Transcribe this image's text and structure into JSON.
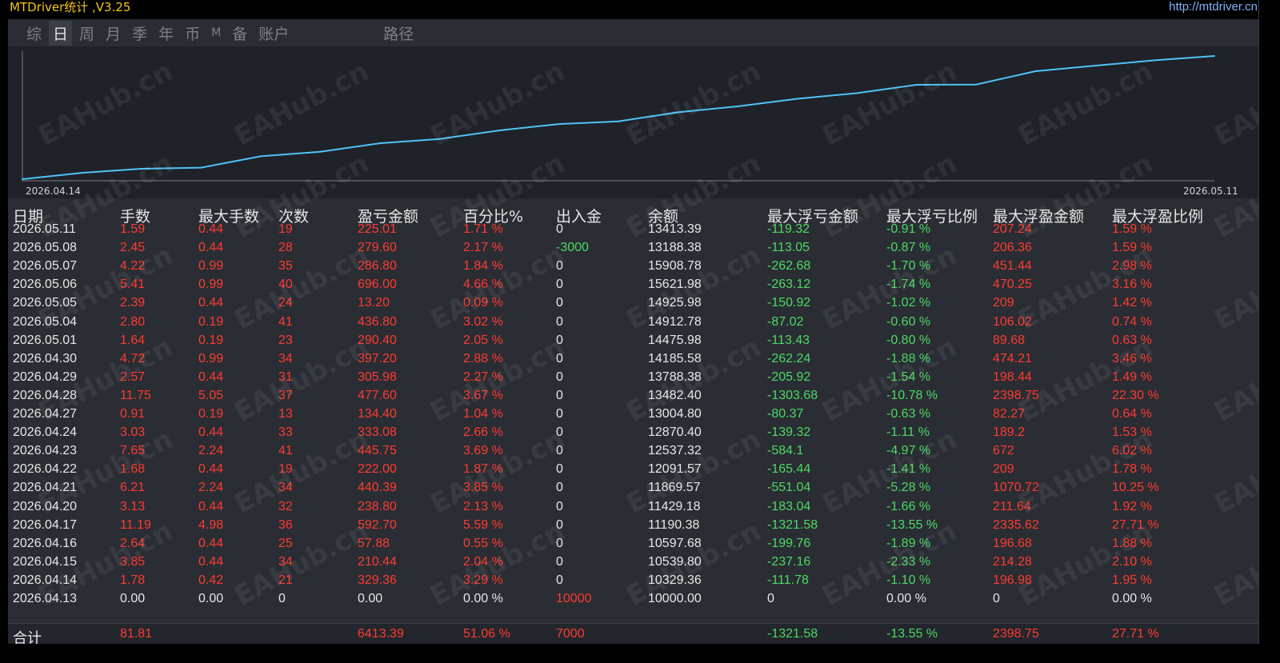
{
  "window": {
    "title": "MTDriver统计 ,V3.25",
    "url": "http://mtdriver.cn"
  },
  "tabs": [
    {
      "label": "综",
      "active": false
    },
    {
      "label": "日",
      "active": true
    },
    {
      "label": "周",
      "active": false
    },
    {
      "label": "月",
      "active": false
    },
    {
      "label": "季",
      "active": false
    },
    {
      "label": "年",
      "active": false
    },
    {
      "label": "币",
      "active": false
    },
    {
      "label": "M",
      "active": false
    },
    {
      "label": "备",
      "active": false
    },
    {
      "label": "账户",
      "active": false
    },
    {
      "label": "路径",
      "active": false
    }
  ],
  "watermark": "EAHub.cn",
  "colors": {
    "positive": "#ff3b30",
    "negative": "#4cd964",
    "neutral": "#e8e8e8",
    "curve": "#4fc3f7"
  },
  "chart_data": {
    "type": "line",
    "x_start_label": "2026.04.14",
    "x_end_label": "2026.05.11",
    "x": [
      "2026.04.13",
      "2026.04.14",
      "2026.04.15",
      "2026.04.16",
      "2026.04.17",
      "2026.04.20",
      "2026.04.21",
      "2026.04.22",
      "2026.04.23",
      "2026.04.24",
      "2026.04.27",
      "2026.04.28",
      "2026.04.29",
      "2026.04.30",
      "2026.05.01",
      "2026.05.04",
      "2026.05.05",
      "2026.05.06",
      "2026.05.07",
      "2026.05.08",
      "2026.05.11"
    ],
    "values": [
      10000.0,
      10329.36,
      10539.8,
      10597.68,
      11190.38,
      11429.18,
      11869.57,
      12091.57,
      12537.32,
      12870.4,
      13004.8,
      13482.4,
      13788.38,
      14185.58,
      14475.98,
      14912.78,
      14925.98,
      15621.98,
      15908.78,
      16188.38,
      16413.39
    ]
  },
  "table": {
    "headers": [
      "日期",
      "手数",
      "最大手数",
      "次数",
      "盈亏金额",
      "百分比%",
      "出入金",
      "余额",
      "最大浮亏金额",
      "最大浮亏比例",
      "最大浮盈金额",
      "最大浮盈比例"
    ],
    "rows": [
      [
        "2026.05.11",
        "1.59",
        "0.44",
        "19",
        "225.01",
        "1.71 %",
        "0",
        "13413.39",
        "-119.32",
        "-0.91 %",
        "207.24",
        "1.59 %"
      ],
      [
        "2026.05.08",
        "2.45",
        "0.44",
        "28",
        "279.60",
        "2.17 %",
        "-3000",
        "13188.38",
        "-113.05",
        "-0.87 %",
        "206.36",
        "1.59 %"
      ],
      [
        "2026.05.07",
        "4.22",
        "0.99",
        "35",
        "286.80",
        "1.84 %",
        "0",
        "15908.78",
        "-262.68",
        "-1.70 %",
        "451.44",
        "2.98 %"
      ],
      [
        "2026.05.06",
        "5.41",
        "0.99",
        "40",
        "696.00",
        "4.66 %",
        "0",
        "15621.98",
        "-263.12",
        "-1.74 %",
        "470.25",
        "3.16 %"
      ],
      [
        "2026.05.05",
        "2.39",
        "0.44",
        "24",
        "13.20",
        "0.09 %",
        "0",
        "14925.98",
        "-150.92",
        "-1.02 %",
        "209",
        "1.42 %"
      ],
      [
        "2026.05.04",
        "2.80",
        "0.19",
        "41",
        "436.80",
        "3.02 %",
        "0",
        "14912.78",
        "-87.02",
        "-0.60 %",
        "106.02",
        "0.74 %"
      ],
      [
        "2026.05.01",
        "1.64",
        "0.19",
        "23",
        "290.40",
        "2.05 %",
        "0",
        "14475.98",
        "-113.43",
        "-0.80 %",
        "89.68",
        "0.63 %"
      ],
      [
        "2026.04.30",
        "4.72",
        "0.99",
        "34",
        "397.20",
        "2.88 %",
        "0",
        "14185.58",
        "-262.24",
        "-1.88 %",
        "474.21",
        "3.46 %"
      ],
      [
        "2026.04.29",
        "2.57",
        "0.44",
        "31",
        "305.98",
        "2.27 %",
        "0",
        "13788.38",
        "-205.92",
        "-1.54 %",
        "198.44",
        "1.49 %"
      ],
      [
        "2026.04.28",
        "11.75",
        "5.05",
        "37",
        "477.60",
        "3.67 %",
        "0",
        "13482.40",
        "-1303.68",
        "-10.78 %",
        "2398.75",
        "22.30 %"
      ],
      [
        "2026.04.27",
        "0.91",
        "0.19",
        "13",
        "134.40",
        "1.04 %",
        "0",
        "13004.80",
        "-80.37",
        "-0.63 %",
        "82.27",
        "0.64 %"
      ],
      [
        "2026.04.24",
        "3.03",
        "0.44",
        "33",
        "333.08",
        "2.66 %",
        "0",
        "12870.40",
        "-139.32",
        "-1.11 %",
        "189.2",
        "1.53 %"
      ],
      [
        "2026.04.23",
        "7.65",
        "2.24",
        "41",
        "445.75",
        "3.69 %",
        "0",
        "12537.32",
        "-584.1",
        "-4.97 %",
        "672",
        "6.02 %"
      ],
      [
        "2026.04.22",
        "1.68",
        "0.44",
        "19",
        "222.00",
        "1.87 %",
        "0",
        "12091.57",
        "-165.44",
        "-1.41 %",
        "209",
        "1.78 %"
      ],
      [
        "2026.04.21",
        "6.21",
        "2.24",
        "34",
        "440.39",
        "3.85 %",
        "0",
        "11869.57",
        "-551.04",
        "-5.28 %",
        "1070.72",
        "10.25 %"
      ],
      [
        "2026.04.20",
        "3.13",
        "0.44",
        "32",
        "238.80",
        "2.13 %",
        "0",
        "11429.18",
        "-183.04",
        "-1.66 %",
        "211.64",
        "1.92 %"
      ],
      [
        "2026.04.17",
        "11.19",
        "4.98",
        "36",
        "592.70",
        "5.59 %",
        "0",
        "11190.38",
        "-1321.58",
        "-13.55 %",
        "2335.62",
        "27.71 %"
      ],
      [
        "2026.04.16",
        "2.64",
        "0.44",
        "25",
        "57.88",
        "0.55 %",
        "0",
        "10597.68",
        "-199.76",
        "-1.89 %",
        "196.68",
        "1.88 %"
      ],
      [
        "2026.04.15",
        "3.85",
        "0.44",
        "34",
        "210.44",
        "2.04 %",
        "0",
        "10539.80",
        "-237.16",
        "-2.33 %",
        "214.28",
        "2.10 %"
      ],
      [
        "2026.04.14",
        "1.78",
        "0.42",
        "21",
        "329.36",
        "3.29 %",
        "0",
        "10329.36",
        "-111.78",
        "-1.10 %",
        "196.98",
        "1.95 %"
      ],
      [
        "2026.04.13",
        "0.00",
        "0.00",
        "0",
        "0.00",
        "0.00 %",
        "10000",
        "10000.00",
        "0",
        "0.00 %",
        "0",
        "0.00 %"
      ]
    ],
    "total": [
      "合计",
      "81.81",
      "",
      "",
      "6413.39",
      "51.06 %",
      "7000",
      "",
      "-1321.58",
      "-13.55 %",
      "2398.75",
      "27.71 %"
    ]
  }
}
